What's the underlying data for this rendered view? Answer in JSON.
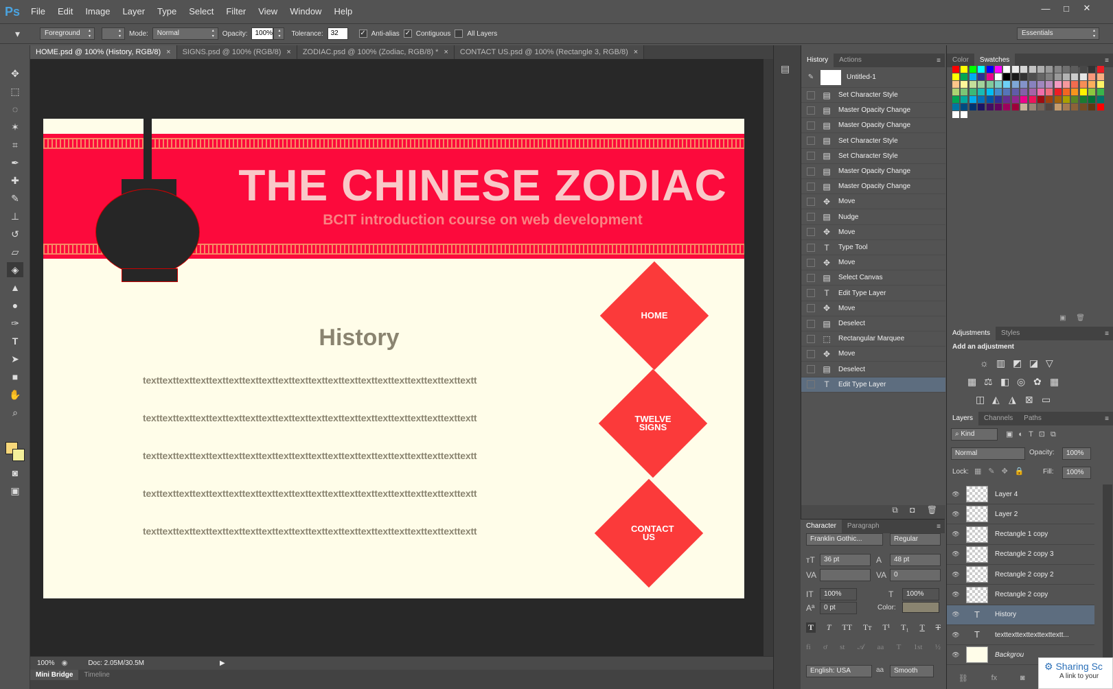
{
  "app": {
    "logo": "Ps"
  },
  "menu": [
    "File",
    "Edit",
    "Image",
    "Layer",
    "Type",
    "Select",
    "Filter",
    "View",
    "Window",
    "Help"
  ],
  "window_controls": {
    "minimize": "—",
    "maximize": "□",
    "close": "✕"
  },
  "options": {
    "fill_source": "Foreground",
    "mode_label": "Mode:",
    "mode": "Normal",
    "opacity_label": "Opacity:",
    "opacity": "100%",
    "tolerance_label": "Tolerance:",
    "tolerance": "32",
    "anti_alias": "Anti-alias",
    "contiguous": "Contiguous",
    "all_layers": "All Layers",
    "workspace": "Essentials"
  },
  "tabs": [
    {
      "label": "HOME.psd @ 100% (History, RGB/8)"
    },
    {
      "label": "SIGNS.psd @ 100% (RGB/8)"
    },
    {
      "label": "ZODIAC.psd @ 100% (Zodiac, RGB/8) *"
    },
    {
      "label": "CONTACT US.psd @ 100% (Rectangle 3, RGB/8)"
    }
  ],
  "canvas": {
    "title": "THE CHINESE ZODIAC",
    "subtitle": "BCIT introduction course on web development",
    "heading": "History",
    "text_lines": [
      "texttexttexttexttexttexttexttexttexttexttexttexttexttexttexttexttexttexttexttextt",
      "texttexttexttexttexttexttexttexttexttexttexttexttexttexttexttexttexttexttexttextt",
      "texttexttexttexttexttexttexttexttexttexttexttexttexttexttexttexttexttexttexttextt",
      "texttexttexttexttexttexttexttexttexttexttexttexttexttexttexttexttexttexttexttextt",
      "texttexttexttexttexttexttexttexttexttexttexttexttexttexttexttexttexttexttexttextt"
    ],
    "nav": {
      "home": "HOME",
      "signs": "TWELVE SIGNS",
      "contact": "CONTACT US"
    },
    "colors": {
      "banner": "#fc0a3c",
      "background": "#fffde9",
      "diamond": "#fb3a3a",
      "text": "#8a8470"
    }
  },
  "status": {
    "zoom": "100%",
    "doc": "Doc: 2.05M/30.5M"
  },
  "bottom_tabs": [
    "Mini Bridge",
    "Timeline"
  ],
  "history_panel": {
    "tabs": [
      "History",
      "Actions"
    ],
    "snapshot": "Untitled-1",
    "items": [
      {
        "label": "Set Character Style",
        "icon": "doc-icon"
      },
      {
        "label": "Master Opacity Change",
        "icon": "doc-icon"
      },
      {
        "label": "Master Opacity Change",
        "icon": "doc-icon"
      },
      {
        "label": "Set Character Style",
        "icon": "doc-icon"
      },
      {
        "label": "Set Character Style",
        "icon": "doc-icon"
      },
      {
        "label": "Master Opacity Change",
        "icon": "doc-icon"
      },
      {
        "label": "Master Opacity Change",
        "icon": "doc-icon"
      },
      {
        "label": "Move",
        "icon": "move-icon"
      },
      {
        "label": "Nudge",
        "icon": "doc-icon"
      },
      {
        "label": "Move",
        "icon": "move-icon"
      },
      {
        "label": "Type Tool",
        "icon": "type-icon"
      },
      {
        "label": "Move",
        "icon": "move-icon"
      },
      {
        "label": "Select Canvas",
        "icon": "doc-icon"
      },
      {
        "label": "Edit Type Layer",
        "icon": "type-icon"
      },
      {
        "label": "Move",
        "icon": "move-icon"
      },
      {
        "label": "Deselect",
        "icon": "doc-icon"
      },
      {
        "label": "Rectangular Marquee",
        "icon": "marquee-icon"
      },
      {
        "label": "Move",
        "icon": "move-icon"
      },
      {
        "label": "Deselect",
        "icon": "doc-icon"
      },
      {
        "label": "Edit Type Layer",
        "icon": "type-icon"
      }
    ]
  },
  "character_panel": {
    "tabs": [
      "Character",
      "Paragraph"
    ],
    "font": "Franklin Gothic...",
    "style": "Regular",
    "size": "36 pt",
    "leading": "48 pt",
    "kerning": "",
    "tracking": "0",
    "vscale": "100%",
    "hscale": "100%",
    "baseline": "0 pt",
    "color_label": "Color:",
    "color": "#8a8470",
    "language": "English: USA",
    "aa_label": "aa",
    "antialias": "Smooth"
  },
  "color_panel": {
    "tabs": [
      "Color",
      "Swatches"
    ]
  },
  "swatches": [
    "#ff0000",
    "#ffff00",
    "#00ff00",
    "#00ffff",
    "#0000ff",
    "#ff00ff",
    "#ffffff",
    "#ebebeb",
    "#d6d6d6",
    "#c2c2c2",
    "#adadad",
    "#999999",
    "#858585",
    "#707070",
    "#5c5c5c",
    "#474747",
    "#333333",
    "#ed1c24",
    "#ffff00",
    "#00a651",
    "#00aeef",
    "#2e3192",
    "#ec008c",
    "#ffffff",
    "#000000",
    "#1a1a1a",
    "#333333",
    "#4d4d4d",
    "#666666",
    "#808080",
    "#999999",
    "#b3b3b3",
    "#cccccc",
    "#e6e6e6",
    "#f7977a",
    "#f9ad81",
    "#fdc68a",
    "#fff79a",
    "#c4df9b",
    "#a2d39c",
    "#82ca9d",
    "#7bcdc8",
    "#6ecff6",
    "#7ea7d8",
    "#8493ca",
    "#8882be",
    "#a187be",
    "#bc8dbf",
    "#f49ac2",
    "#f6989d",
    "#f26c4f",
    "#f68e56",
    "#fbaf5c",
    "#fff467",
    "#acd372",
    "#7cc576",
    "#3bb878",
    "#1abbb4",
    "#00bff3",
    "#438ccb",
    "#5574b9",
    "#605ca8",
    "#855fa8",
    "#a763a8",
    "#f06eaa",
    "#f26d7d",
    "#ed1c24",
    "#f26522",
    "#f7941d",
    "#fff200",
    "#8dc73f",
    "#39b54a",
    "#00a651",
    "#00a99d",
    "#00aeef",
    "#0072bc",
    "#0054a6",
    "#2e3192",
    "#662d91",
    "#92278f",
    "#ec008c",
    "#ed145b",
    "#9e0b0f",
    "#a0410d",
    "#a36209",
    "#aba000",
    "#598527",
    "#1a7b30",
    "#007236",
    "#00746b",
    "#0076a3",
    "#004b80",
    "#003471",
    "#1b1464",
    "#440e62",
    "#630460",
    "#9e005d",
    "#9e0039",
    "#c7b299",
    "#998675",
    "#736357",
    "#534741",
    "#c69c6d",
    "#a67c52",
    "#8c6239",
    "#754c24",
    "#603913",
    "#ff0000",
    "#ffffff",
    "#ffffff"
  ],
  "adjustments": {
    "tabs": [
      "Adjustments",
      "Styles"
    ],
    "hint": "Add an adjustment"
  },
  "layers_panel": {
    "tabs": [
      "Layers",
      "Channels",
      "Paths"
    ],
    "filter": "Kind",
    "blend": "Normal",
    "opacity_label": "Opacity:",
    "opacity": "100%",
    "lock_label": "Lock:",
    "fill_label": "Fill:",
    "fill": "100%",
    "layers": [
      {
        "name": "Layer 4",
        "kind": "raster"
      },
      {
        "name": "Layer 2",
        "kind": "raster"
      },
      {
        "name": "Rectangle 1 copy",
        "kind": "raster"
      },
      {
        "name": "Rectangle 2 copy 3",
        "kind": "raster"
      },
      {
        "name": "Rectangle 2 copy 2",
        "kind": "raster"
      },
      {
        "name": "Rectangle 2 copy",
        "kind": "raster"
      },
      {
        "name": "History",
        "kind": "text"
      },
      {
        "name": "texttexttexttexttexttextt...",
        "kind": "text"
      },
      {
        "name": "Backgrou",
        "kind": "background"
      }
    ]
  },
  "notification": {
    "title": "Sharing Sc",
    "body": "A link to your"
  }
}
